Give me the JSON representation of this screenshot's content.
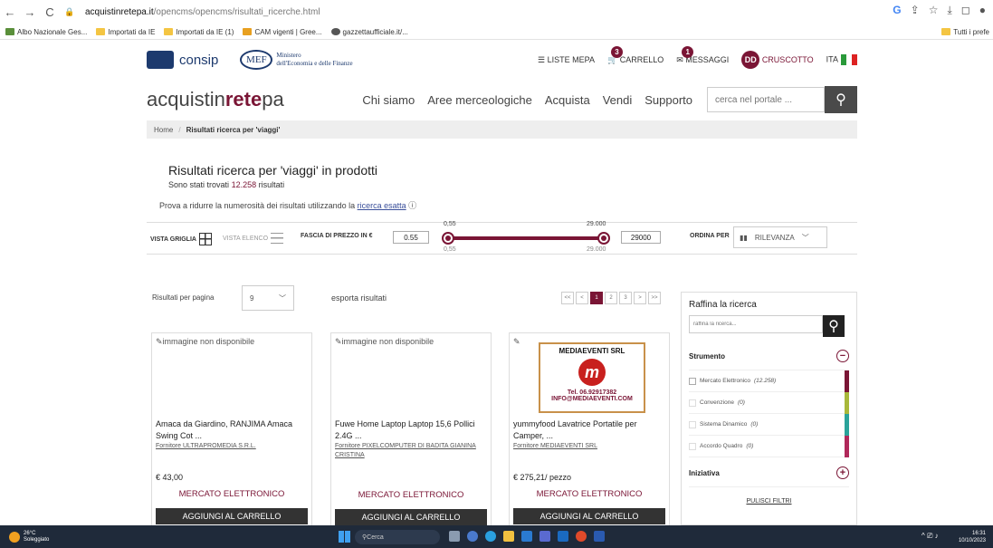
{
  "browser": {
    "url_host": "acquistinretepa.it",
    "url_path": "/opencms/opencms/risultati_ricerche.html",
    "bookmarks": [
      "Albo Nazionale Ges...",
      "Importati da IE",
      "Importati da IE (1)",
      "CAM vigenti | Gree...",
      "gazzettaufficiale.it/..."
    ],
    "bookmark_right": "Tutti i prefe"
  },
  "header": {
    "consip": "consip",
    "mef": "MEF",
    "mef_text_1": "Ministero",
    "mef_text_2": "dell'Economia e delle Finanze",
    "liste_mepa": "LISTE MEPA",
    "carrello": "CARRELLO",
    "carrello_count": "3",
    "messaggi": "MESSAGGI",
    "messaggi_count": "1",
    "user_initials": "DD",
    "cruscotto": "CRUSCOTTO",
    "lang": "ITA"
  },
  "nav": {
    "brand_a": "acquistin",
    "brand_b": "rete",
    "brand_c": "pa",
    "items": [
      "Chi siamo",
      "Aree merceologiche",
      "Acquista",
      "Vendi",
      "Supporto"
    ],
    "search_placeholder": "cerca nel portale ..."
  },
  "breadcrumb": {
    "home": "Home",
    "sep": "/",
    "current": "Risultati ricerca per 'viaggi'"
  },
  "results": {
    "title": "Risultati ricerca per 'viaggi' in prodotti",
    "found_prefix": "Sono stati trovati",
    "found_count": "12.258",
    "found_suffix": "risultati",
    "hint_prefix": "Prova a ridurre la numerosità dei risultati utilizzando la",
    "hint_link": "ricerca esatta"
  },
  "filters": {
    "vista_griglia": "VISTA GRIGLIA",
    "vista_elenco": "VISTA ELENCO",
    "fascia": "FASCIA DI PREZZO IN €",
    "min": "0.55",
    "max": "29000",
    "min_label": "0,55",
    "max_label": "29.000",
    "ordina": "ORDINA PER",
    "sort": "RILEVANZA"
  },
  "listing": {
    "per_page_label": "Risultati per pagina",
    "per_page": "9",
    "export": "esporta risultati",
    "pages": [
      "<<",
      "<",
      "1",
      "2",
      "3",
      ">",
      ">>"
    ]
  },
  "products": [
    {
      "img": "immagine non disponibile",
      "name": "Amaca da Giardino, RANJIMA Amaca Swing Cot ...",
      "supplier": "Fornitore ULTRAPROMEDIA S.R.L.",
      "price": "€ 43,00",
      "market": "MERCATO ELETTRONICO",
      "cart": "AGGIUNGI AL CARRELLO"
    },
    {
      "img": "immagine non disponibile",
      "name": "Fuwe Home Laptop Laptop 15,6 Pollici 2.4G ...",
      "supplier": "Fornitore PIXELCOMPUTER DI BADITA GIANINA CRISTINA",
      "price": "",
      "market": "MERCATO ELETTRONICO",
      "cart": "AGGIUNGI AL CARRELLO"
    },
    {
      "img_title": "MEDIAEVENTI SRL",
      "img_tel": "Tel. 06.92917382",
      "img_mail": "INFO@MEDIAEVENTI.COM",
      "name": "yummyfood Lavatrice Portatile per Camper, ...",
      "supplier": "Fornitore MEDIAEVENTI SRL",
      "price": "€ 275,21/ pezzo",
      "market": "MERCATO ELETTRONICO",
      "cart": "AGGIUNGI AL CARRELLO"
    }
  ],
  "sidebar": {
    "title": "Raffina la ricerca",
    "placeholder": "raffina la ricerca...",
    "strumento": "Strumento",
    "options": [
      {
        "label": "Mercato Elettronico",
        "count": "(12.258)",
        "color": "#7a1535"
      },
      {
        "label": "Convenzione",
        "count": "(0)",
        "color": "#a8b83a"
      },
      {
        "label": "Sistema Dinamico",
        "count": "(0)",
        "color": "#2aa39a"
      },
      {
        "label": "Accordo Quadro",
        "count": "(0)",
        "color": "#b0285a"
      }
    ],
    "iniziativa": "Iniziativa",
    "pulisci": "PULISCI FILTRI"
  },
  "taskbar": {
    "temp": "26°C",
    "weather": "Soleggiato",
    "search": "Cerca",
    "time": "16:31",
    "date": "10/10/2023"
  },
  "colors": {
    "accent": "#7a1535"
  }
}
